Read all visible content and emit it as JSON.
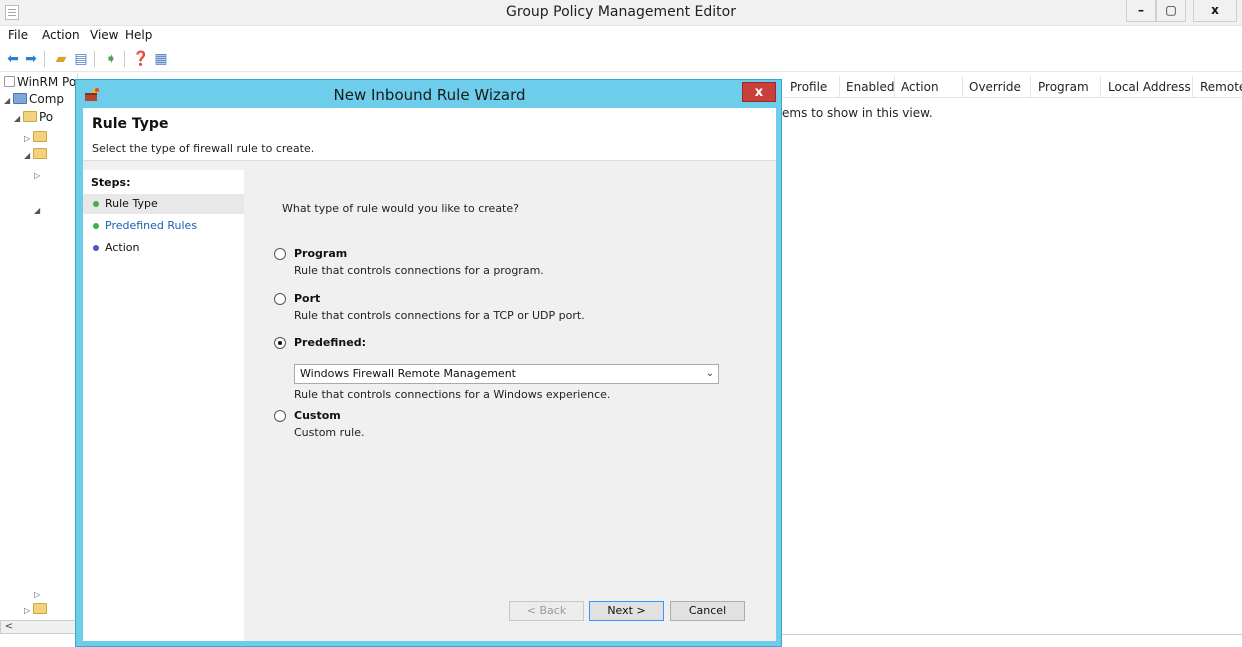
{
  "app": {
    "title": "Group Policy Management Editor",
    "window_buttons": {
      "minimize": "–",
      "maximize": "▢",
      "close": "x"
    }
  },
  "menu": [
    "File",
    "Action",
    "View",
    "Help"
  ],
  "tree": {
    "rows": [
      {
        "label": "WinRM Po",
        "expander": ""
      },
      {
        "label": "Comp",
        "expander": "◢"
      },
      {
        "label": "Po",
        "expander": "◢"
      },
      {
        "label": "",
        "expander": "▷"
      },
      {
        "label": "",
        "expander": "◢"
      },
      {
        "label": "",
        "expander": "▷"
      },
      {
        "label": "",
        "expander": "◢"
      },
      {
        "label": "",
        "expander": "▷"
      },
      {
        "label": "",
        "expander": "▷"
      }
    ],
    "scroll_left": "<"
  },
  "list": {
    "columns": [
      "Profile",
      "Enabled",
      "Action",
      "Override",
      "Program",
      "Local Address",
      "Remote"
    ],
    "empty_message": "ems to show in this view."
  },
  "wizard": {
    "title": "New Inbound Rule Wizard",
    "close": "x",
    "heading": "Rule Type",
    "subheading": "Select the type of firewall rule to create.",
    "steps_title": "Steps:",
    "steps": [
      {
        "label": "Rule Type",
        "color": "#3cb043",
        "text_color": "#111111"
      },
      {
        "label": "Predefined Rules",
        "color": "#3cb043",
        "text_color": "#1a5fb4"
      },
      {
        "label": "Action",
        "color": "#4a56b8",
        "text_color": "#111111"
      }
    ],
    "question": "What type of rule would you like to create?",
    "options": [
      {
        "label": "Program",
        "desc": "Rule that controls connections for a program.",
        "selected": false
      },
      {
        "label": "Port",
        "desc": "Rule that controls connections for a TCP or UDP port.",
        "selected": false
      },
      {
        "label": "Predefined:",
        "desc": "",
        "selected": true
      },
      {
        "label": "Custom",
        "desc": "Custom rule.",
        "selected": false
      }
    ],
    "predefined_value": "Windows Firewall Remote Management",
    "predefined_desc": "Rule that controls connections for a Windows experience.",
    "buttons": {
      "back": "< Back",
      "next": "Next >",
      "cancel": "Cancel"
    }
  },
  "colors": {
    "accent": "#6dcdea",
    "close_red": "#c9403a",
    "step_done": "#3cb043"
  }
}
